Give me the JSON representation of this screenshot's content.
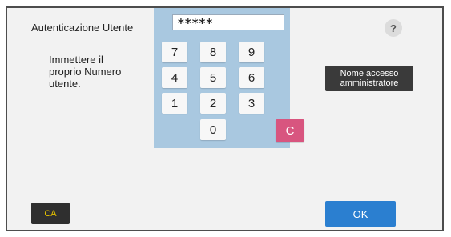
{
  "header": {
    "title": "Autenticazione Utente",
    "help_label": "?"
  },
  "instruction": {
    "line1": "Immettere il",
    "line2": "proprio Numero",
    "line3": "utente."
  },
  "keypad": {
    "pin_value": "*****",
    "keys": [
      "7",
      "8",
      "9",
      "4",
      "5",
      "6",
      "1",
      "2",
      "3",
      "0"
    ],
    "clear_label": "C"
  },
  "admin_button": {
    "line1": "Nome accesso",
    "line2": "amministratore"
  },
  "footer": {
    "ca_label": "CA",
    "ok_label": "OK"
  },
  "colors": {
    "keypad_panel": "#a9c8e0",
    "clear_key": "#d8557f",
    "ok_button": "#2b7fd0",
    "ca_text": "#e6c200"
  }
}
